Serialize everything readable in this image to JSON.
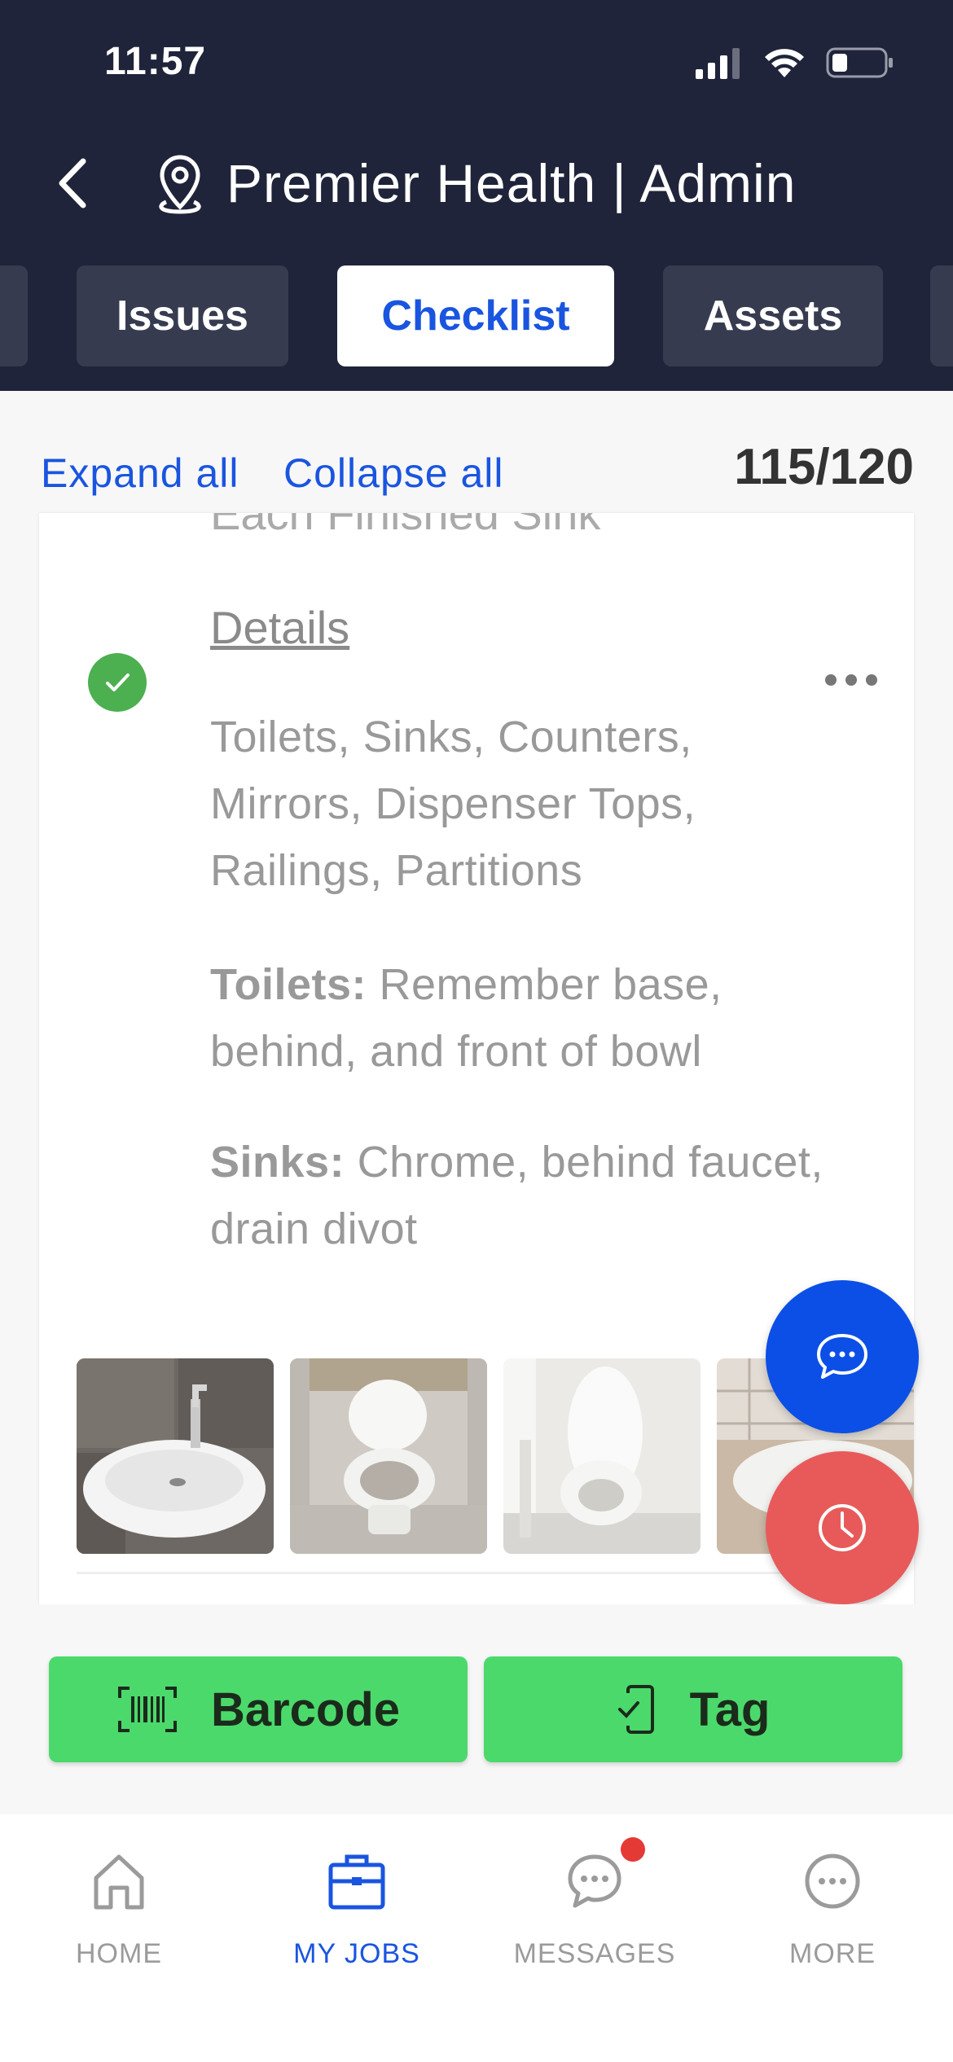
{
  "status_bar": {
    "time": "11:57",
    "icons": [
      "cellular-signal-icon",
      "wifi-icon",
      "battery-icon"
    ]
  },
  "header": {
    "back_icon": "chevron-left-icon",
    "location_icon": "map-pin-icon",
    "title": "Premier Health | Admin"
  },
  "tabs": [
    {
      "label": "Issues",
      "active": false
    },
    {
      "label": "Checklist",
      "active": true
    },
    {
      "label": "Assets",
      "active": false
    }
  ],
  "toolbar": {
    "expand_all": "Expand all",
    "collapse_all": "Collapse all",
    "progress": "115/120"
  },
  "checklist_item": {
    "cut_off_title": "Each Finished Sink",
    "details_label": "Details",
    "status": "completed",
    "description": "Toilets, Sinks, Counters, Mirrors, Dispenser Tops, Railings, Partitions",
    "toilets_label": "Toilets:",
    "toilets_text": " Remember base, behind, and front of bowl",
    "sinks_label": "Sinks:",
    "sinks_text": " Chrome, behind faucet, drain divot",
    "photos": [
      "sink-photo",
      "toilet-photo",
      "toilet-photo",
      "bathtub-photo"
    ]
  },
  "fabs": {
    "chat_icon": "chat-bubble-icon",
    "timer_icon": "clock-icon"
  },
  "actions": {
    "barcode_label": "Barcode",
    "tag_label": "Tag"
  },
  "bottom_nav": [
    {
      "label": "HOME",
      "icon": "home-icon",
      "active": false
    },
    {
      "label": "MY JOBS",
      "icon": "briefcase-icon",
      "active": true
    },
    {
      "label": "MESSAGES",
      "icon": "message-icon",
      "active": false,
      "badge": true
    },
    {
      "label": "MORE",
      "icon": "more-icon",
      "active": false
    }
  ],
  "colors": {
    "header_bg": "#20243a",
    "accent_blue": "#1a55e0",
    "green": "#4cd96c",
    "fab_red": "#e85a5a",
    "check_green": "#4caf50"
  }
}
